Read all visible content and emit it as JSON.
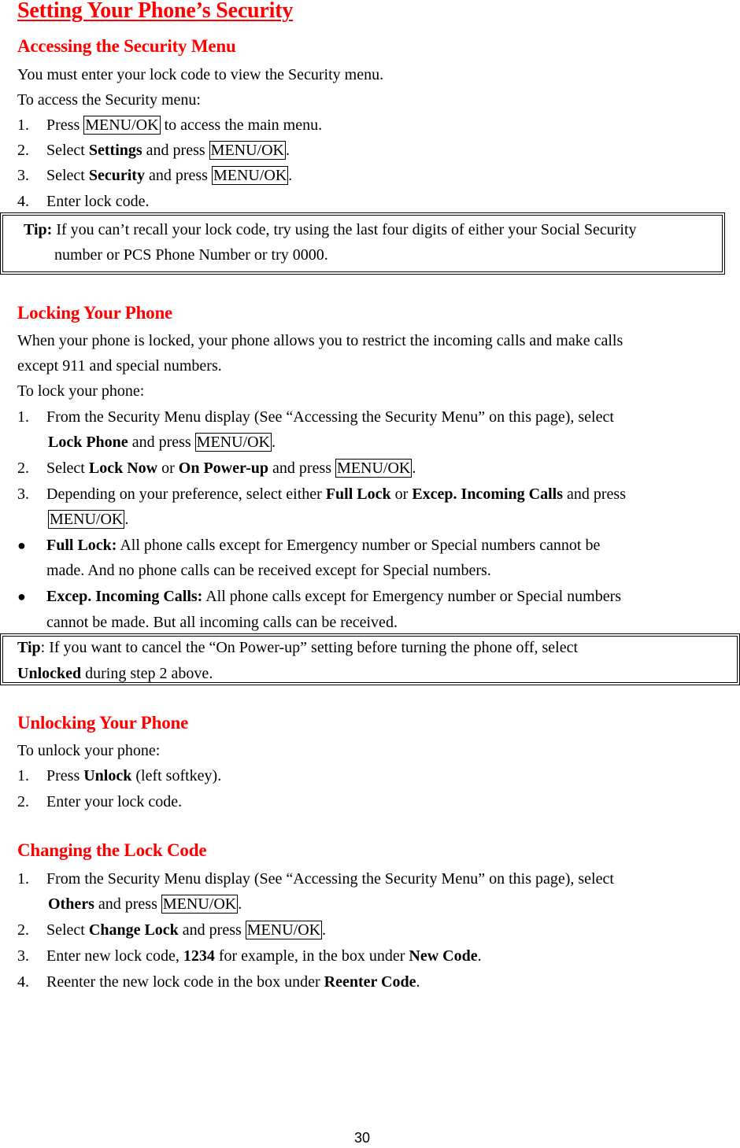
{
  "page_title": "Setting Your Phone’s Security",
  "key_label": "MENU/OK",
  "sections": {
    "accessing": {
      "heading": "Accessing the Security Menu",
      "intro": "You must enter your lock code to view the Security menu.",
      "lead": "To access the Security menu:",
      "steps": [
        {
          "num": "1.",
          "pre": "Press ",
          "post": " to access the main menu."
        },
        {
          "num": "2.",
          "pre": "Select ",
          "bold": "Settings",
          "mid": " and press ",
          "post": "."
        },
        {
          "num": "3.",
          "pre": "Select ",
          "bold": "Security",
          "mid": " and press ",
          "post": "."
        },
        {
          "num": "4.",
          "text": "Enter lock code."
        }
      ],
      "tip": {
        "label": "Tip:",
        "line1": " If you can’t recall your lock code, try using the last four digits of either your Social Security",
        "line2": "number or PCS Phone Number or try 0000."
      }
    },
    "locking": {
      "heading": "Locking Your Phone",
      "intro_line1": "When your phone is locked, your phone allows you to restrict the incoming calls and make calls",
      "intro_line2": "except 911 and special numbers.",
      "lead": "To lock your phone:",
      "step1": {
        "num": "1.",
        "line1": "From the Security Menu display (See “Accessing the Security Menu” on this page), select",
        "bold": "Lock Phone",
        "mid": " and press ",
        "post": "."
      },
      "step2": {
        "num": "2.",
        "pre": "Select ",
        "bold1": "Lock Now",
        "or": " or ",
        "bold2": "On Power-up",
        "mid": " and press ",
        "post": "."
      },
      "step3": {
        "num": "3.",
        "pre": "Depending on your preference, select either ",
        "bold1": "Full Lock",
        "or": " or ",
        "bold2": "Excep. Incoming Calls",
        "mid": " and press",
        "post": "."
      },
      "bullets": [
        {
          "bold": "Full Lock:",
          "line1": " All phone calls except for Emergency number or Special numbers cannot be",
          "line2": "made. And no phone calls can be received except for Special numbers."
        },
        {
          "bold": "Excep. Incoming Calls:",
          "line1": " All phone calls except for Emergency number or Special numbers",
          "line2": "cannot be made. But all incoming calls can be received."
        }
      ],
      "bullet_glyph": "●",
      "tip": {
        "label": "Tip",
        "line1": ": If you want to cancel the “On Power-up” setting before turning the phone off, select",
        "bold2": "Unlocked",
        "line2": " during step 2 above."
      }
    },
    "unlocking": {
      "heading": "Unlocking Your Phone",
      "lead": "To unlock your phone:",
      "step1": {
        "num": "1.",
        "pre": "Press ",
        "bold": "Unlock",
        "post": " (left softkey)."
      },
      "step2": {
        "num": "2.",
        "text": "Enter your lock code."
      }
    },
    "changing": {
      "heading": "Changing the Lock Code",
      "step1": {
        "num": "1.",
        "line1": "From the Security Menu display (See “Accessing the Security Menu” on this page), select",
        "bold": "Others",
        "mid": " and press ",
        "post": "."
      },
      "step2": {
        "num": "2.",
        "pre": "Select ",
        "bold": "Change Lock",
        "mid": " and press ",
        "post": "."
      },
      "step3": {
        "num": "3.",
        "pre": "Enter new lock code, ",
        "bold1": "1234",
        "mid": " for example, in the box under ",
        "bold2": "New Code",
        "post": "."
      },
      "step4": {
        "num": "4.",
        "pre": "Reenter the new lock code in the box under ",
        "bold": "Reenter Code",
        "post": "."
      }
    }
  },
  "page_number": "30"
}
